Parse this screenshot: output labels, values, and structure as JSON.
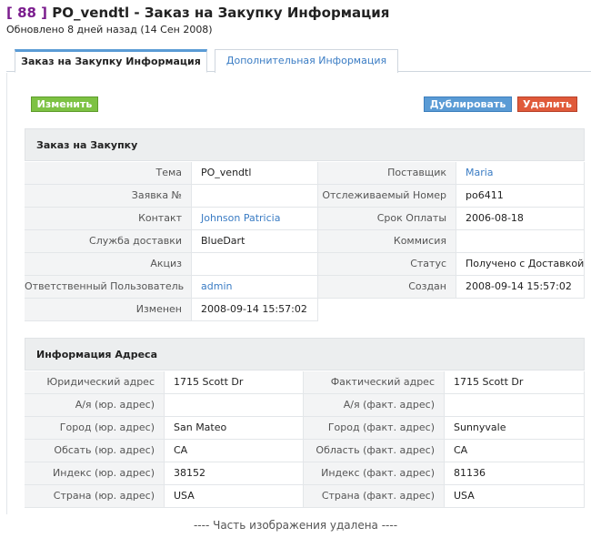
{
  "header": {
    "record_number": "[ 88 ]",
    "title": "PO_vendtl - Заказ на Закупку Информация",
    "updated": "Обновлено 8 дней назад (14 Сен 2008)"
  },
  "tabs": [
    {
      "label": "Заказ на Закупку Информация",
      "active": true
    },
    {
      "label": "Дополнительная Информация",
      "active": false
    }
  ],
  "buttons": {
    "edit": "Изменить",
    "duplicate": "Дублировать",
    "delete": "Удалить"
  },
  "colors": {
    "edit": "#7dc243",
    "duplicate": "#5a9bd5",
    "delete": "#e05a3a",
    "link": "#3a7cc4",
    "record_number": "#7b1d8e"
  },
  "po_section": {
    "title": "Заказ на Закупку",
    "rows": [
      {
        "l1": "Тема",
        "v1": "PO_vendtl",
        "l2": "Поставщик",
        "v2": "Maria"
      },
      {
        "l1": "Заявка №",
        "v1": "",
        "l2": "Отслеживаемый Номер",
        "v2": "po6411"
      },
      {
        "l1": "Контакт",
        "v1": "Johnson Patricia",
        "l2": "Срок Оплаты",
        "v2": "2006-08-18"
      },
      {
        "l1": "Служба доставки",
        "v1": "BlueDart",
        "l2": "Коммисия",
        "v2": ""
      },
      {
        "l1": "Акциз",
        "v1": "",
        "l2": "Статус",
        "v2": "Получено с Доставкой"
      },
      {
        "l1": "Ответственный Пользователь",
        "v1": "admin",
        "l2": "Создан",
        "v2": "2008-09-14 15:57:02"
      },
      {
        "l1": "Изменен",
        "v1": "2008-09-14 15:57:02"
      }
    ]
  },
  "address_section": {
    "title": "Информация Адреса",
    "rows": [
      {
        "l1": "Юридический адрес",
        "v1": "1715 Scott Dr",
        "l2": "Фактический адрес",
        "v2": "1715 Scott Dr"
      },
      {
        "l1": "А/я (юр. адрес)",
        "v1": "",
        "l2": "А/я (факт. адрес)",
        "v2": ""
      },
      {
        "l1": "Город (юр. адрес)",
        "v1": "San Mateo",
        "l2": "Город (факт. адрес)",
        "v2": "Sunnyvale"
      },
      {
        "l1": "Обсать (юр. адрес)",
        "v1": "CA",
        "l2": "Область (факт. адрес)",
        "v2": "CA"
      },
      {
        "l1": "Индекс (юр. адрес)",
        "v1": "38152",
        "l2": "Индекс (факт. адрес)",
        "v2": "81136"
      },
      {
        "l1": "Страна (юр. адрес)",
        "v1": "USA",
        "l2": "Страна (факт. адрес)",
        "v2": "USA"
      }
    ]
  },
  "footer_note": "---- Часть изображения удалена ----"
}
